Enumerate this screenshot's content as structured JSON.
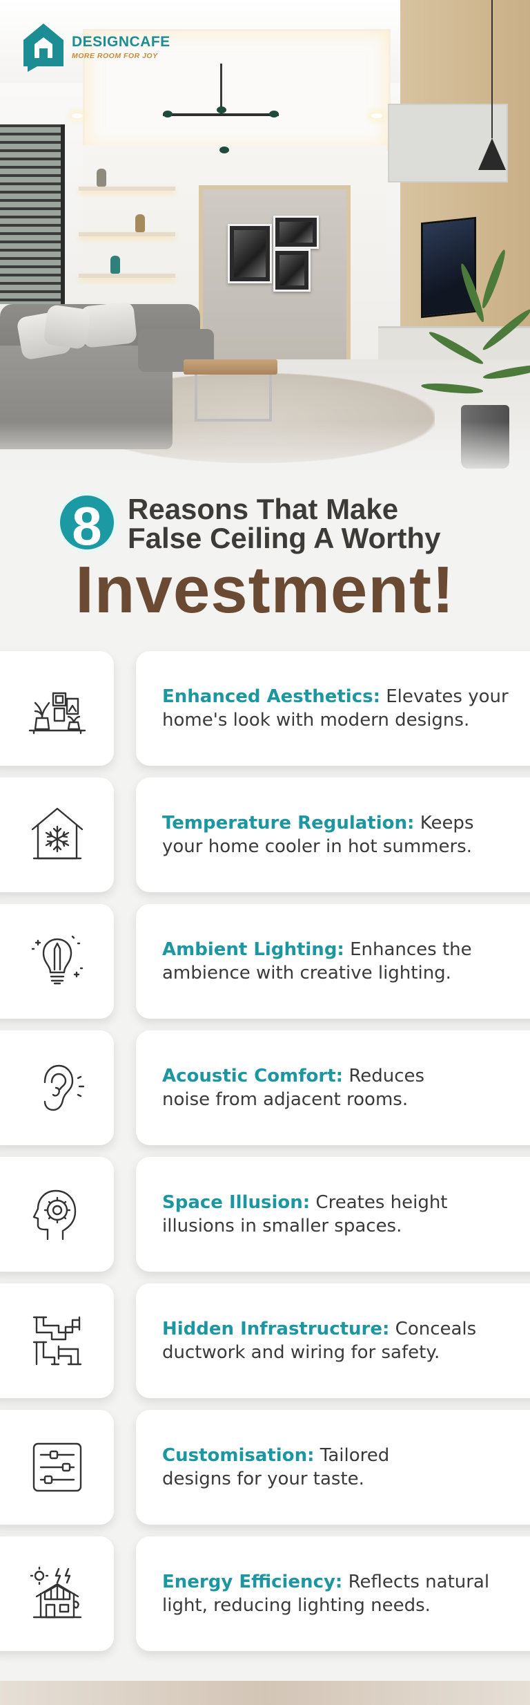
{
  "brand": {
    "name": "DESIGNCAFE",
    "tagline": "MORE ROOM FOR JOY",
    "color_primary": "#1c8d93",
    "color_accent": "#c98b39"
  },
  "headline": {
    "number": "8",
    "line1": "Reasons That Make",
    "line2": "False Ceiling A Worthy",
    "line3": "Investment!"
  },
  "colors": {
    "term": "#1c96a0",
    "title_big": "#6a4a32"
  },
  "reasons": [
    {
      "icon": "decor-shelf-icon",
      "term": "Enhanced Aesthetics:",
      "line_a": "Elevates your",
      "line_b": "home's look with modern designs."
    },
    {
      "icon": "house-snowflake-icon",
      "term": "Temperature Regulation:",
      "line_a": "Keeps",
      "line_b": "your home cooler in hot summers."
    },
    {
      "icon": "lightbulb-pencil-icon",
      "term": "Ambient Lighting:",
      "line_a": "Enhances the",
      "line_b": "ambience with creative lighting."
    },
    {
      "icon": "ear-sound-icon",
      "term": "Acoustic Comfort:",
      "line_a": "Reduces",
      "line_b": "noise from adjacent rooms."
    },
    {
      "icon": "head-mind-icon",
      "term": "Space Illusion:",
      "line_a": "Creates height",
      "line_b": "illusions in smaller spaces."
    },
    {
      "icon": "pipes-icon",
      "term": "Hidden Infrastructure:",
      "line_a": "Conceals",
      "line_b": "ductwork and wiring for safety."
    },
    {
      "icon": "sliders-panel-icon",
      "term": "Customisation:",
      "line_a": "Tailored",
      "line_b": "designs for your taste."
    },
    {
      "icon": "solar-house-icon",
      "term": "Energy Efficiency:",
      "line_a": "Reflects natural",
      "line_b": "light, reducing lighting needs."
    }
  ]
}
